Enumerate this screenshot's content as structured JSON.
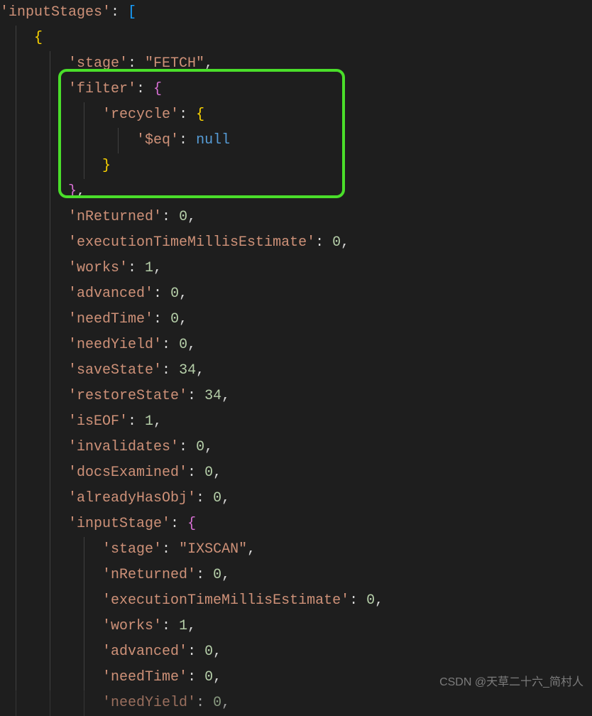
{
  "code": {
    "l1_key": "'inputStages'",
    "l3_key": "'stage'",
    "l3_val": "\"FETCH\"",
    "l4_key": "'filter'",
    "l5_key": "'recycle'",
    "l6_key": "'$eq'",
    "l6_val": "null",
    "l9_key": "'nReturned'",
    "l9_val": "0",
    "l10_key": "'executionTimeMillisEstimate'",
    "l10_val": "0",
    "l11_key": "'works'",
    "l11_val": "1",
    "l12_key": "'advanced'",
    "l12_val": "0",
    "l13_key": "'needTime'",
    "l13_val": "0",
    "l14_key": "'needYield'",
    "l14_val": "0",
    "l15_key": "'saveState'",
    "l15_val": "34",
    "l16_key": "'restoreState'",
    "l16_val": "34",
    "l17_key": "'isEOF'",
    "l17_val": "1",
    "l18_key": "'invalidates'",
    "l18_val": "0",
    "l19_key": "'docsExamined'",
    "l19_val": "0",
    "l20_key": "'alreadyHasObj'",
    "l20_val": "0",
    "l21_key": "'inputStage'",
    "l22_key": "'stage'",
    "l22_val": "\"IXSCAN\"",
    "l23_key": "'nReturned'",
    "l23_val": "0",
    "l24_key": "'executionTimeMillisEstimate'",
    "l24_val": "0",
    "l25_key": "'works'",
    "l25_val": "1",
    "l26_key": "'advanced'",
    "l26_val": "0",
    "l27_key": "'needTime'",
    "l27_val": "0",
    "l28_key": "'needYield'",
    "l28_val": "0"
  },
  "watermark": "CSDN @天草二十六_简村人"
}
